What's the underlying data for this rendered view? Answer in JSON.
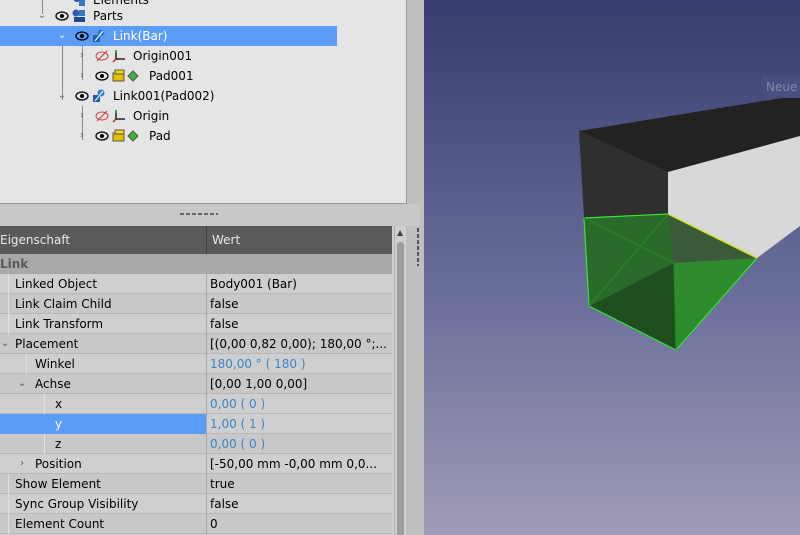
{
  "tree": {
    "items": [
      {
        "label": "Elements",
        "icon": "body-icon"
      },
      {
        "label": "Parts",
        "icon": "part-icon"
      },
      {
        "label": "Link(Bar)",
        "icon": "link-icon",
        "selected": true
      },
      {
        "label": "Origin001",
        "icon": "origin-icon"
      },
      {
        "label": "Pad001",
        "icon": "pad-icon"
      },
      {
        "label": "Link001(Pad002)",
        "icon": "link-icon"
      },
      {
        "label": "Origin",
        "icon": "origin-icon"
      },
      {
        "label": "Pad",
        "icon": "pad-icon"
      }
    ]
  },
  "properties": {
    "header": {
      "name": "Eigenschaft",
      "value": "Wert"
    },
    "group": "Link",
    "rows": [
      {
        "name": "Linked Object",
        "value": "Body001 (Bar)"
      },
      {
        "name": "Link Claim Child",
        "value": "false"
      },
      {
        "name": "Link Transform",
        "value": "false"
      },
      {
        "name": "Placement",
        "value": "[(0,00 0,82 0,00); 180,00 °;..."
      },
      {
        "name": "Winkel",
        "value": "180,00 °  ( 180 )"
      },
      {
        "name": "Achse",
        "value": "[0,00 1,00 0,00]"
      },
      {
        "name": "x",
        "value": "0,00  ( 0 )"
      },
      {
        "name": "y",
        "value": "1,00  ( 1 )"
      },
      {
        "name": "z",
        "value": "0,00  ( 0 )"
      },
      {
        "name": "Position",
        "value": "[-50,00 mm  -0,00 mm  0,0..."
      },
      {
        "name": "Show Element",
        "value": "true"
      },
      {
        "name": "Sync Group Visibility",
        "value": "false"
      },
      {
        "name": "Element Count",
        "value": "0"
      }
    ]
  },
  "view3d": {
    "overlay_label": "Neue"
  },
  "colors": {
    "selection": "#5b9cf6",
    "highlight": "#2e8b2e",
    "value_blue": "#3a86c8"
  }
}
